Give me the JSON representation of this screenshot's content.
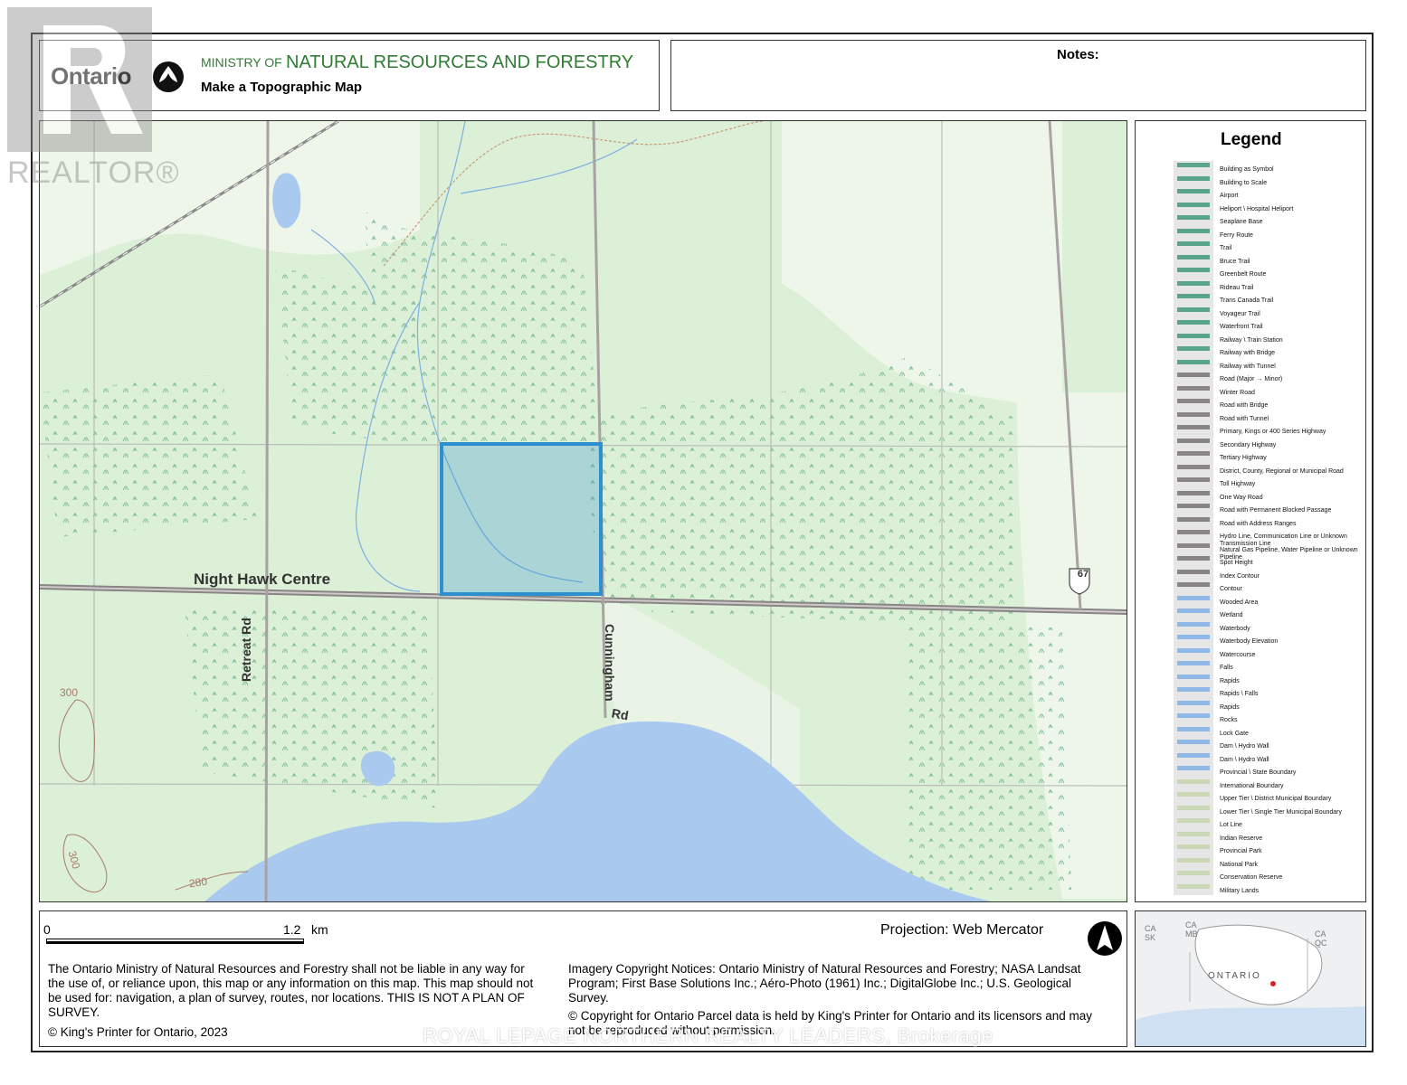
{
  "header": {
    "ontario_label": "Ontario",
    "ministry_prefix": "MINISTRY OF",
    "ministry_name": "NATURAL RESOURCES AND FORESTRY",
    "subtitle": "Make a Topographic Map"
  },
  "notes": {
    "label": "Notes:"
  },
  "map": {
    "road_label": "Night Hawk Centre",
    "retreat_road": "Retreat Rd",
    "cunningham_road": "Cunningham",
    "cunningham_road_suffix": "Rd",
    "highway_shield": "67",
    "contour_labels": [
      "300",
      "300",
      "280"
    ]
  },
  "legend": {
    "title": "Legend",
    "items": [
      "Building as Symbol",
      "Building to Scale",
      "Airport",
      "Heliport \\ Hospital Heliport",
      "Seaplane Base",
      "Ferry Route",
      "Trail",
      "Bruce Trail",
      "Greenbelt Route",
      "Rideau Trail",
      "Trans Canada Trail",
      "Voyageur Trail",
      "Waterfront Trail",
      "Railway \\ Train Station",
      "Railway with Bridge",
      "Railway with Tunnel",
      "Road (Major → Minor)",
      "Winter Road",
      "Road with Bridge",
      "Road with Tunnel",
      "Primary, Kings or 400 Series Highway",
      "Secondary Highway",
      "Tertiary Highway",
      "District, County, Regional or Municipal Road",
      "Toll Highway",
      "One Way Road",
      "Road with Permanent Blocked Passage",
      "Road with Address Ranges",
      "Hydro Line, Communication Line or Unknown Transmission Line",
      "Natural Gas Pipeline, Water Pipeline or Unknown Pipeline",
      "Spot Height",
      "Index Contour",
      "Contour",
      "Wooded Area",
      "Wetland",
      "Waterbody",
      "Waterbody Elevation",
      "Watercourse",
      "Falls",
      "Rapids",
      "Rapids \\ Falls",
      "Rapids",
      "Rocks",
      "Lock Gate",
      "Dam \\ Hydro Wall",
      "Dam \\ Hydro Wall",
      "Provincial \\ State Boundary",
      "International Boundary",
      "Upper Tier \\ District Municipal Boundary",
      "Lower Tier \\ Single Tier Municipal Boundary",
      "Lot Line",
      "Indian Reserve",
      "Provincial Park",
      "National Park",
      "Conservation Reserve",
      "Military Lands"
    ]
  },
  "scale": {
    "zero": "0",
    "distance": "1.2",
    "unit": "km"
  },
  "projection": "Projection: Web Mercator",
  "disclaimer": "The Ontario Ministry of Natural Resources and Forestry shall not be liable in any way for the use of, or reliance upon, this map or any information on this map.  This map should not be used for: navigation, a plan of survey, routes, nor locations. THIS IS NOT A PLAN OF SURVEY.",
  "copyright_kings": "© King's Printer for Ontario,  2023",
  "imagery_notice": "Imagery Copyright Notices: Ontario Ministry of Natural Resources and Forestry; NASA Landsat Program; First Base Solutions Inc.; Aéro-Photo (1961) Inc.; DigitalGlobe Inc.; U.S. Geological Survey.",
  "parcel_notice": "© Copyright for Ontario Parcel data is held by King's Printer for Ontario and its licensors and may not be reproduced without permission.",
  "inset": {
    "labels": [
      "CA SK",
      "CA MB",
      "CA QC",
      "ONTARIO"
    ]
  },
  "watermarks": {
    "realtor": "REALTOR®",
    "brokerage": "ROYAL LEPAGE NORTHERN REALTY LEADERS, Brokerage"
  },
  "colors": {
    "ministry_green": "#2f7d33",
    "parcel_outline": "#2b8fd0",
    "water": "#a9c9ef",
    "wetland_forest": "#cfe8cc",
    "road": "#8a8585"
  }
}
